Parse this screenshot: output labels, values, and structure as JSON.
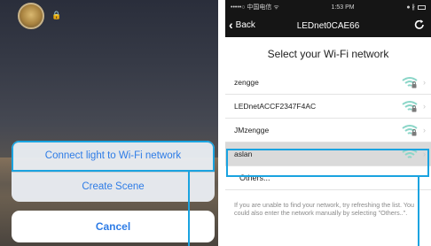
{
  "left_screen": {
    "device_name": "🔒",
    "actions": [
      {
        "label": "Connect light to Wi-Fi network"
      },
      {
        "label": "Create Scene"
      }
    ],
    "cancel_label": "Cancel"
  },
  "right_screen": {
    "status": {
      "carrier": "•••••○ 中国电信 ᯤ",
      "time": "1:53 PM",
      "right": "● ∦"
    },
    "nav": {
      "back_label": "Back",
      "title": "LEDnet0CAE66"
    },
    "heading": "Select your Wi-Fi network",
    "networks": [
      {
        "name": "zengge"
      },
      {
        "name": "LEDnetACCF2347F4AC"
      },
      {
        "name": "JMzengge"
      },
      {
        "name": "aslan"
      }
    ],
    "others_label": "Others...",
    "help": "If you are unable to find your network, try refreshing the list. You could also enter the network manually by selecting \"Others..\"."
  },
  "colors": {
    "accent": "#1aa3e0",
    "ios_blue": "#2e7ce6",
    "wifi_green": "#8bd6c8"
  },
  "icons": {
    "back": "chevron-left-icon",
    "refresh": "refresh-icon",
    "wifi": "wifi-lock-icon",
    "row_chevron": "chevron-right-icon"
  }
}
